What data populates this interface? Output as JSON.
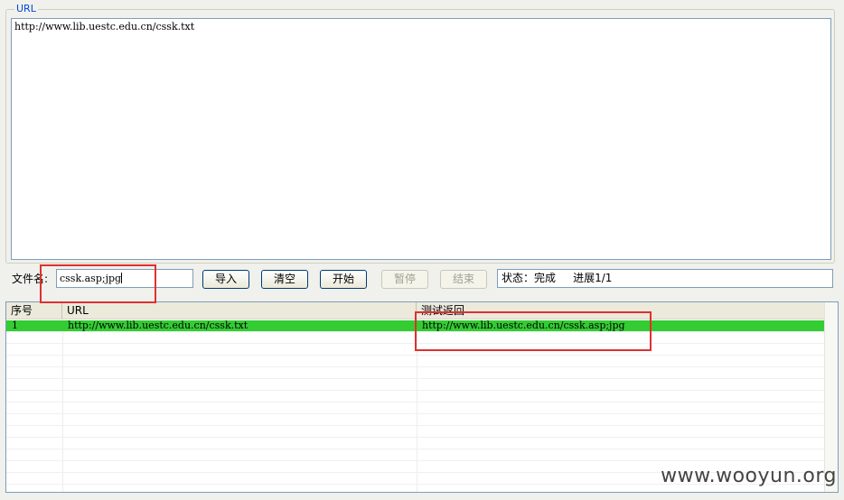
{
  "url_group": {
    "legend": "URL",
    "textarea_value": "http://www.lib.uestc.edu.cn/cssk.txt"
  },
  "toolbar": {
    "filename_label": "文件名:",
    "filename_value": "cssk.asp;jpg",
    "import_label": "导入",
    "clear_label": "清空",
    "start_label": "开始",
    "pause_label": "暂停",
    "stop_label": "结束",
    "status_text": "状态：完成     进展1/1"
  },
  "results": {
    "columns": [
      "序号",
      "URL",
      "测试返回"
    ],
    "rows": [
      [
        "1",
        "http://www.lib.uestc.edu.cn/cssk.txt",
        "http://www.lib.uestc.edu.cn/cssk.asp;jpg"
      ]
    ],
    "selected_row_color": "#33cc33"
  },
  "watermark": "www.wooyun.org",
  "colors": {
    "highlight_box": "#e03030",
    "legend": "#0046d5"
  }
}
